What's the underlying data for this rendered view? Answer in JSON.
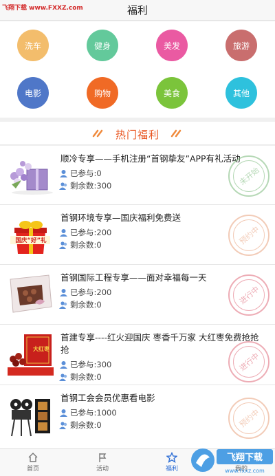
{
  "watermark": {
    "top_left": "飞翔下载 www.FXXZ.com",
    "bottom_right": "飞翔下载",
    "bottom_right_small": "www.fxxz.com"
  },
  "header": {
    "title": "福利"
  },
  "categories": [
    {
      "label": "洗车",
      "color": "#f3bd6c"
    },
    {
      "label": "健身",
      "color": "#63c99b"
    },
    {
      "label": "美发",
      "color": "#ea5aa2"
    },
    {
      "label": "旅游",
      "color": "#c96e6e"
    },
    {
      "label": "电影",
      "color": "#4f77c8"
    },
    {
      "label": "购物",
      "color": "#f06a25"
    },
    {
      "label": "美食",
      "color": "#7bc43b"
    },
    {
      "label": "其他",
      "color": "#2ec1dd"
    }
  ],
  "section": {
    "title": "热门福利"
  },
  "items": [
    {
      "title": "顺冷专享——手机注册“首钢挚友”APP有礼活动",
      "joined": "已参与:0",
      "remaining": "剩余数:300",
      "status": "未开始",
      "status_color": "#7ab97a",
      "thumb_icon": "flower-gift-thumbnail"
    },
    {
      "title": "首钢环境专享—国庆福利免费送",
      "joined": "已参与:200",
      "remaining": "剩余数:0",
      "status": "预约中",
      "status_color": "#e9a27e",
      "thumb_icon": "national-day-gift-thumbnail",
      "thumb_text": "国庆“好”礼"
    },
    {
      "title": "首钢国际工程专享——面对幸福每一天",
      "joined": "已参与:200",
      "remaining": "剩余数:0",
      "status": "进行中",
      "status_color": "#e06a7a",
      "thumb_icon": "chocolate-box-thumbnail"
    },
    {
      "title": "首建专享----红火迎国庆 枣香千万家 大红枣免费抢抢抢",
      "joined": "已参与:300",
      "remaining": "剩余数:0",
      "status": "进行中",
      "status_color": "#e06a7a",
      "thumb_icon": "red-dates-thumbnail",
      "thumb_text": "大红枣"
    },
    {
      "title": "首钢工会会员优惠看电影",
      "joined": "已参与:1000",
      "remaining": "剩余数:0",
      "status": "预约中",
      "status_color": "#e9a27e",
      "thumb_icon": "film-projector-thumbnail"
    }
  ],
  "tabbar": [
    {
      "label": "首页",
      "icon": "home-icon"
    },
    {
      "label": "活动",
      "icon": "flag-icon"
    },
    {
      "label": "福利",
      "icon": "star-icon",
      "active": true
    },
    {
      "label": "我的",
      "icon": "user-icon"
    }
  ]
}
